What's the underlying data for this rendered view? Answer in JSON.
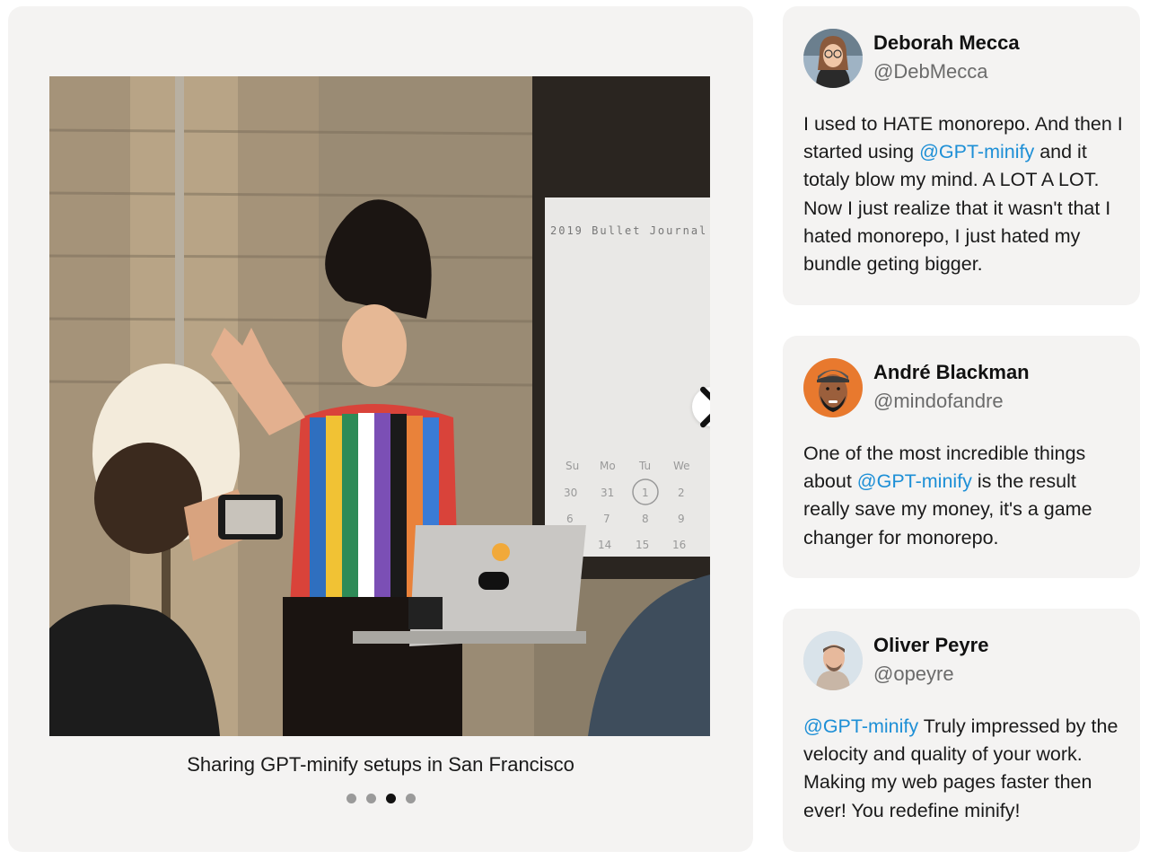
{
  "carousel": {
    "caption": "Sharing GPT-minify setups in San Francisco",
    "next_icon": "chevron-right-icon",
    "slides": 4,
    "active_slide": 3
  },
  "photo": {
    "screen_title": "2019 Bullet Journal",
    "calendar_days": [
      "Su",
      "Mo",
      "Tu",
      "We"
    ],
    "calendar_row1": [
      "30",
      "31",
      "1",
      "2"
    ],
    "calendar_row2": [
      "6",
      "7",
      "8",
      "9"
    ],
    "calendar_row3": [
      "14",
      "15",
      "16"
    ]
  },
  "testimonials": [
    {
      "name": "Deborah Mecca",
      "handle": "@DebMecca",
      "quote_before": "I used to HATE monorepo. And then I started using ",
      "mention": "@GPT-minify",
      "quote_after": " and it totaly blow my mind. A LOT A LOT. Now I just realize that it wasn't that I hated monorepo, I just hated my bundle geting bigger."
    },
    {
      "name": "André Blackman",
      "handle": "@mindofandre",
      "quote_before": "One of the most incredible things about ",
      "mention": "@GPT-minify",
      "quote_after": " is the result really save my money, it's a game changer for monorepo."
    },
    {
      "name": "Oliver Peyre",
      "handle": "@opeyre",
      "quote_before": "",
      "mention": "@GPT-minify",
      "quote_after": " Truly impressed by the velocity and quality of your work. Making my web pages faster then ever! You redefine minify!"
    }
  ],
  "colors": {
    "card_bg": "#f4f3f2",
    "mention": "#1d8fd6",
    "dot_active": "#111111",
    "dot_inactive": "#9a9a9a"
  }
}
